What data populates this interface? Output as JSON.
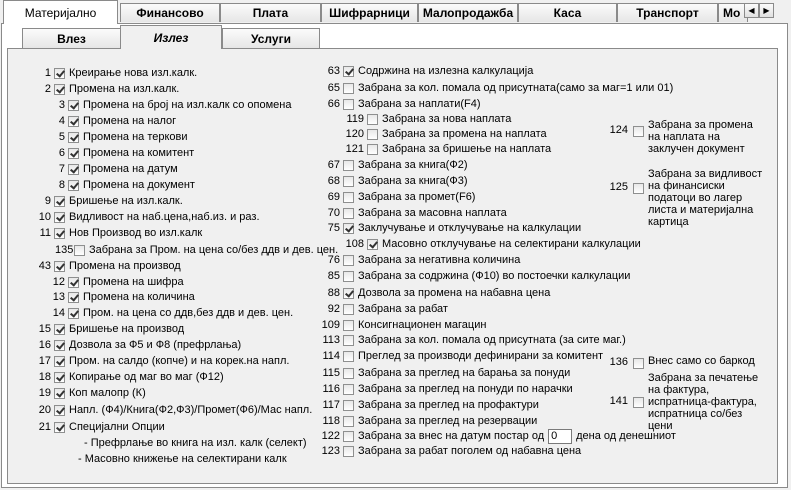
{
  "top_tabs": [
    "Материјално",
    "Финансово",
    "Плата",
    "Шифрарници",
    "Малопродажба",
    "Каса",
    "Транспорт",
    "Мо"
  ],
  "sub_tabs": [
    "Влез",
    "Излез",
    "Услуги"
  ],
  "left": [
    {
      "n": "1",
      "label": "Креирање нова изл.калк.",
      "checked": true
    },
    {
      "n": "2",
      "label": "Промена на изл.калк.",
      "checked": true
    },
    {
      "n": "3",
      "label": "Промена на број на изл.калк со опомена",
      "checked": true
    },
    {
      "n": "4",
      "label": "Промена на налог",
      "checked": true
    },
    {
      "n": "5",
      "label": "Промена на теркови",
      "checked": true
    },
    {
      "n": "6",
      "label": "Промена на комитент",
      "checked": true
    },
    {
      "n": "7",
      "label": "Промена на датум",
      "checked": true
    },
    {
      "n": "8",
      "label": "Промена на документ",
      "checked": true
    },
    {
      "n": "9",
      "label": "Бришење на изл.калк.",
      "checked": true
    },
    {
      "n": "10",
      "label": "Видливост на наб.цена,наб.из. и раз.",
      "checked": true
    },
    {
      "n": "11",
      "label": "Нов Производ во изл.калк",
      "checked": true
    },
    {
      "n": "135",
      "label": "Забрана за Пром. на цена со/без ддв и дев. цен.",
      "checked": false
    },
    {
      "n": "43",
      "label": "Промена на производ",
      "checked": true
    },
    {
      "n": "12",
      "label": "Промена на шифра",
      "checked": true
    },
    {
      "n": "13",
      "label": "Промена на количина",
      "checked": true
    },
    {
      "n": "14",
      "label": "Пром. на цена со ддв,без ддв и дев. цен.",
      "checked": true
    },
    {
      "n": "15",
      "label": "Бришење на производ",
      "checked": true
    },
    {
      "n": "16",
      "label": "Дозвола за Ф5 и Ф8 (префрлања)",
      "checked": true
    },
    {
      "n": "17",
      "label": "Пром. на салдо (копче) и на корек.на напл.",
      "checked": true
    },
    {
      "n": "18",
      "label": "Копирање од маг во маг (Ф12)",
      "checked": true
    },
    {
      "n": "19",
      "label": "Коп малопр (К)",
      "checked": true
    },
    {
      "n": "20",
      "label": "Напл. (Ф4)/Книга(Ф2,Ф3)/Промет(Ф6)/Мас напл.",
      "checked": true
    },
    {
      "n": "21",
      "label": "Специјални Опции",
      "checked": true
    }
  ],
  "special_options": [
    "- Префрлање во книга на изл. калк (селект)",
    "- Масовно книжење на селектирани калк"
  ],
  "middle": [
    {
      "n": "63",
      "label": "Содржина на излезна калкулација",
      "checked": true
    },
    {
      "n": "65",
      "label": "Забрана за кол. помала од присутната(само за маг=1 или 01)",
      "checked": false
    },
    {
      "n": "66",
      "label": "Забрана за наплати(F4)",
      "checked": false
    },
    {
      "n": "119",
      "label": "Забрана за нова наплата",
      "checked": false
    },
    {
      "n": "120",
      "label": "Забрана за промена на наплата",
      "checked": false
    },
    {
      "n": "121",
      "label": "Забрана за бришење на наплата",
      "checked": false
    },
    {
      "n": "67",
      "label": "Забрана за книга(Ф2)",
      "checked": false
    },
    {
      "n": "68",
      "label": "Забрана за книга(Ф3)",
      "checked": false
    },
    {
      "n": "69",
      "label": "Забрана за промет(F6)",
      "checked": false
    },
    {
      "n": "70",
      "label": "Забрана за масовна наплата",
      "checked": false
    },
    {
      "n": "75",
      "label": "Заклучување и отклучување на калкулации",
      "checked": true
    },
    {
      "n": "108",
      "label": "Масовно отклучување на селектирани калкулации",
      "checked": true
    },
    {
      "n": "76",
      "label": "Забрана за негативна количина",
      "checked": false
    },
    {
      "n": "85",
      "label": "Забрана за содржина (Ф10) во постоечки калкулации",
      "checked": false
    },
    {
      "n": "88",
      "label": "Дозвола за промена на набавна цена",
      "checked": true
    },
    {
      "n": "92",
      "label": "Забрана за рабат",
      "checked": false
    },
    {
      "n": "109",
      "label": "Консигнационен магацин",
      "checked": false
    },
    {
      "n": "113",
      "label": "Забрана за кол. помала од присутната (за сите маг.)",
      "checked": false
    },
    {
      "n": "114",
      "label": "Преглед за производи дефинирани за комитент",
      "checked": false
    },
    {
      "n": "115",
      "label": "Забрана за преглед на барања за понуди",
      "checked": false
    },
    {
      "n": "116",
      "label": "Забрана за преглед на понуди по нарачки",
      "checked": false
    },
    {
      "n": "117",
      "label": "Забрана за преглед на профактури",
      "checked": false
    },
    {
      "n": "118",
      "label": "Забрана за преглед на резервации",
      "checked": false
    },
    {
      "n": "122",
      "label": "Забрана за внес на датум постар од",
      "checked": false,
      "value": "0",
      "suffix": "дена од денешниот"
    },
    {
      "n": "123",
      "label": "Забрана за рабат поголем од набавна цена",
      "checked": false
    }
  ],
  "right": [
    {
      "n": "124",
      "label": "Забрана за промена на наплата на заклучен документ",
      "checked": false
    },
    {
      "n": "125",
      "label": "Забрана за видливост на финансиски податоци во лагер листа и материјална картица",
      "checked": false
    },
    {
      "n": "136",
      "label": "Внес само со баркод",
      "checked": false
    },
    {
      "n": "141",
      "label": "Забрана за печатење на фактура, испратница-фактура, испратница со/без цени",
      "checked": false
    }
  ],
  "icons": {
    "scroll_left": "arrow-left-icon",
    "scroll_right": "arrow-right-icon"
  }
}
